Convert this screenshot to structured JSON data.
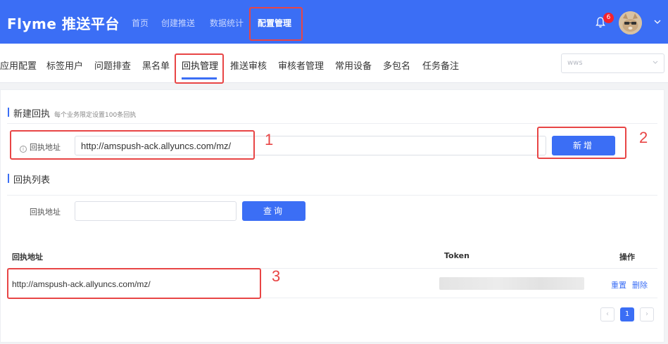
{
  "header": {
    "logo": "Flyme 推送平台",
    "nav": [
      "首页",
      "创建推送",
      "数据统计",
      "配置管理"
    ],
    "notification_count": "6"
  },
  "subnav": {
    "items": [
      "应用配置",
      "标签用户",
      "问题排查",
      "黑名单",
      "回执管理",
      "推送审核",
      "审核者管理",
      "常用设备",
      "多包名",
      "任务备注"
    ],
    "select_value": "wws"
  },
  "create": {
    "title": "新建回执",
    "note": "每个业务限定设置100条回执",
    "field_label": "回执地址",
    "field_value": "http://amspush-ack.allyuncs.com/mz/",
    "add_button": "新增"
  },
  "list": {
    "title": "回执列表",
    "filter_label": "回执地址",
    "filter_value": "",
    "query_button": "查询",
    "columns": [
      "回执地址",
      "Token",
      "操作"
    ],
    "rows": [
      {
        "url": "http://amspush-ack.allyuncs.com/mz/",
        "actions": [
          "重置",
          "删除"
        ]
      }
    ],
    "pagination": {
      "prev": "‹",
      "current": "1",
      "next": "›"
    }
  },
  "annotations": [
    "1",
    "2",
    "3"
  ]
}
